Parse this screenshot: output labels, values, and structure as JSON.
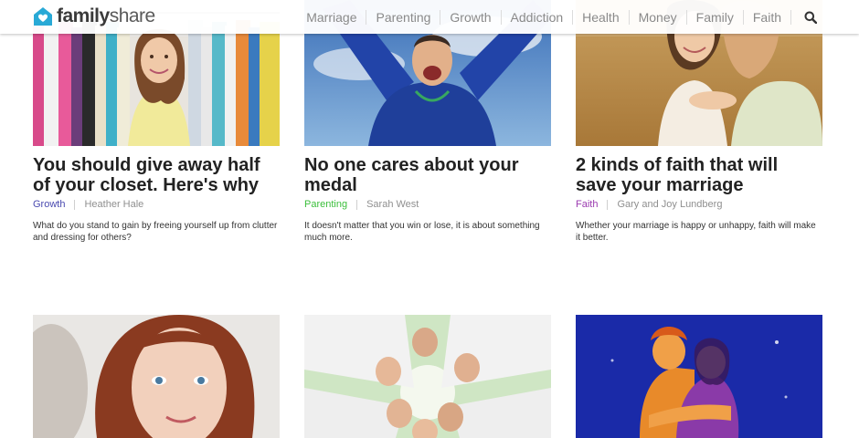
{
  "header": {
    "brand_bold": "family",
    "brand_light": "share",
    "nav": [
      "Marriage",
      "Parenting",
      "Growth",
      "Addiction",
      "Health",
      "Money",
      "Family",
      "Faith"
    ]
  },
  "articles": [
    {
      "title": "You should give away half of your closet. Here's why",
      "category": "Growth",
      "category_color": "#4a4ab0",
      "author": "Heather Hale",
      "summary": "What do you stand to gain by freeing yourself up from clutter and dressing for others?"
    },
    {
      "title": "No one cares about your medal",
      "category": "Parenting",
      "category_color": "#3cbf3c",
      "author": "Sarah West",
      "summary": "It doesn't matter that you win or lose, it is about something much more."
    },
    {
      "title": "2 kinds of faith that will save your marriage",
      "category": "Faith",
      "category_color": "#9b3bb0",
      "author": "Gary and Joy Lundberg",
      "summary": "Whether your marriage is happy or unhappy, faith will make it better."
    }
  ],
  "colors": {
    "brand_icon": "#29a9d6",
    "nav_text": "#8a8a8a"
  }
}
